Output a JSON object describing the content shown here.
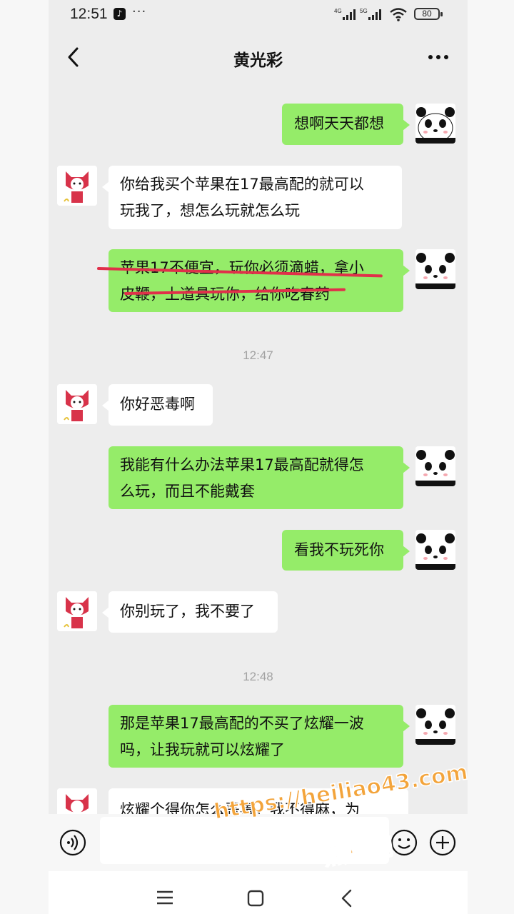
{
  "status_bar": {
    "time": "12:51",
    "app_icon": "tiktok-icon",
    "overflow": "···",
    "network_1": "4G",
    "network_2": "5G",
    "battery": "80"
  },
  "header": {
    "title": "黄光彩",
    "back_icon": "chevron-left-icon",
    "more_icon": "more-dots-icon"
  },
  "messages": [
    {
      "side": "out",
      "text": "想啊天天都想",
      "avatar": "panda-avatar"
    },
    {
      "side": "in",
      "lines": [
        "你给我买个苹果在17最高配的就可以",
        "玩我了，想怎么玩就怎么玩"
      ],
      "avatar": "fox-avatar"
    },
    {
      "side": "out",
      "lines": [
        "苹果17不便宜，玩你必须滴蜡，拿小",
        "皮鞭，上道具玩你，给你吃春药"
      ],
      "struck_through": true,
      "avatar": "panda-avatar"
    },
    {
      "timestamp": "12:47"
    },
    {
      "side": "in",
      "text": "你好恶毒啊",
      "avatar": "fox-avatar"
    },
    {
      "side": "out",
      "lines": [
        "我能有什么办法苹果17最高配就得怎",
        "么玩，而且不能戴套"
      ],
      "avatar": "panda-avatar"
    },
    {
      "side": "out",
      "text": "看我不玩死你",
      "avatar": "panda-avatar"
    },
    {
      "side": "in",
      "text": "你别玩了，我不要了",
      "avatar": "fox-avatar"
    },
    {
      "timestamp": "12:48"
    },
    {
      "side": "out",
      "lines": [
        "那是苹果17最高配的不买了炫耀一波",
        "吗，让我玩就可以炫耀了"
      ],
      "avatar": "panda-avatar"
    },
    {
      "side": "in",
      "text": "炫耀个得你怎么恶毒，我不得麻，为",
      "avatar": "fox-avatar",
      "partially_visible": true
    }
  ],
  "input_bar": {
    "voice_icon": "voice-icon",
    "emoji_icon": "emoji-icon",
    "plus_icon": "plus-icon",
    "text_value": ""
  },
  "nav_bar": {
    "menu_icon": "menu-icon",
    "home_icon": "home-square-icon",
    "back_icon": "back-triangle-icon"
  },
  "watermark": {
    "url": "https://heiliao43.com",
    "brand": "黑料网"
  },
  "colors": {
    "outgoing_bubble": "#95ec69",
    "incoming_bubble": "#ffffff",
    "chat_background": "#ededed",
    "strike_line": "#e0304a",
    "watermark": "#f3a43b"
  }
}
